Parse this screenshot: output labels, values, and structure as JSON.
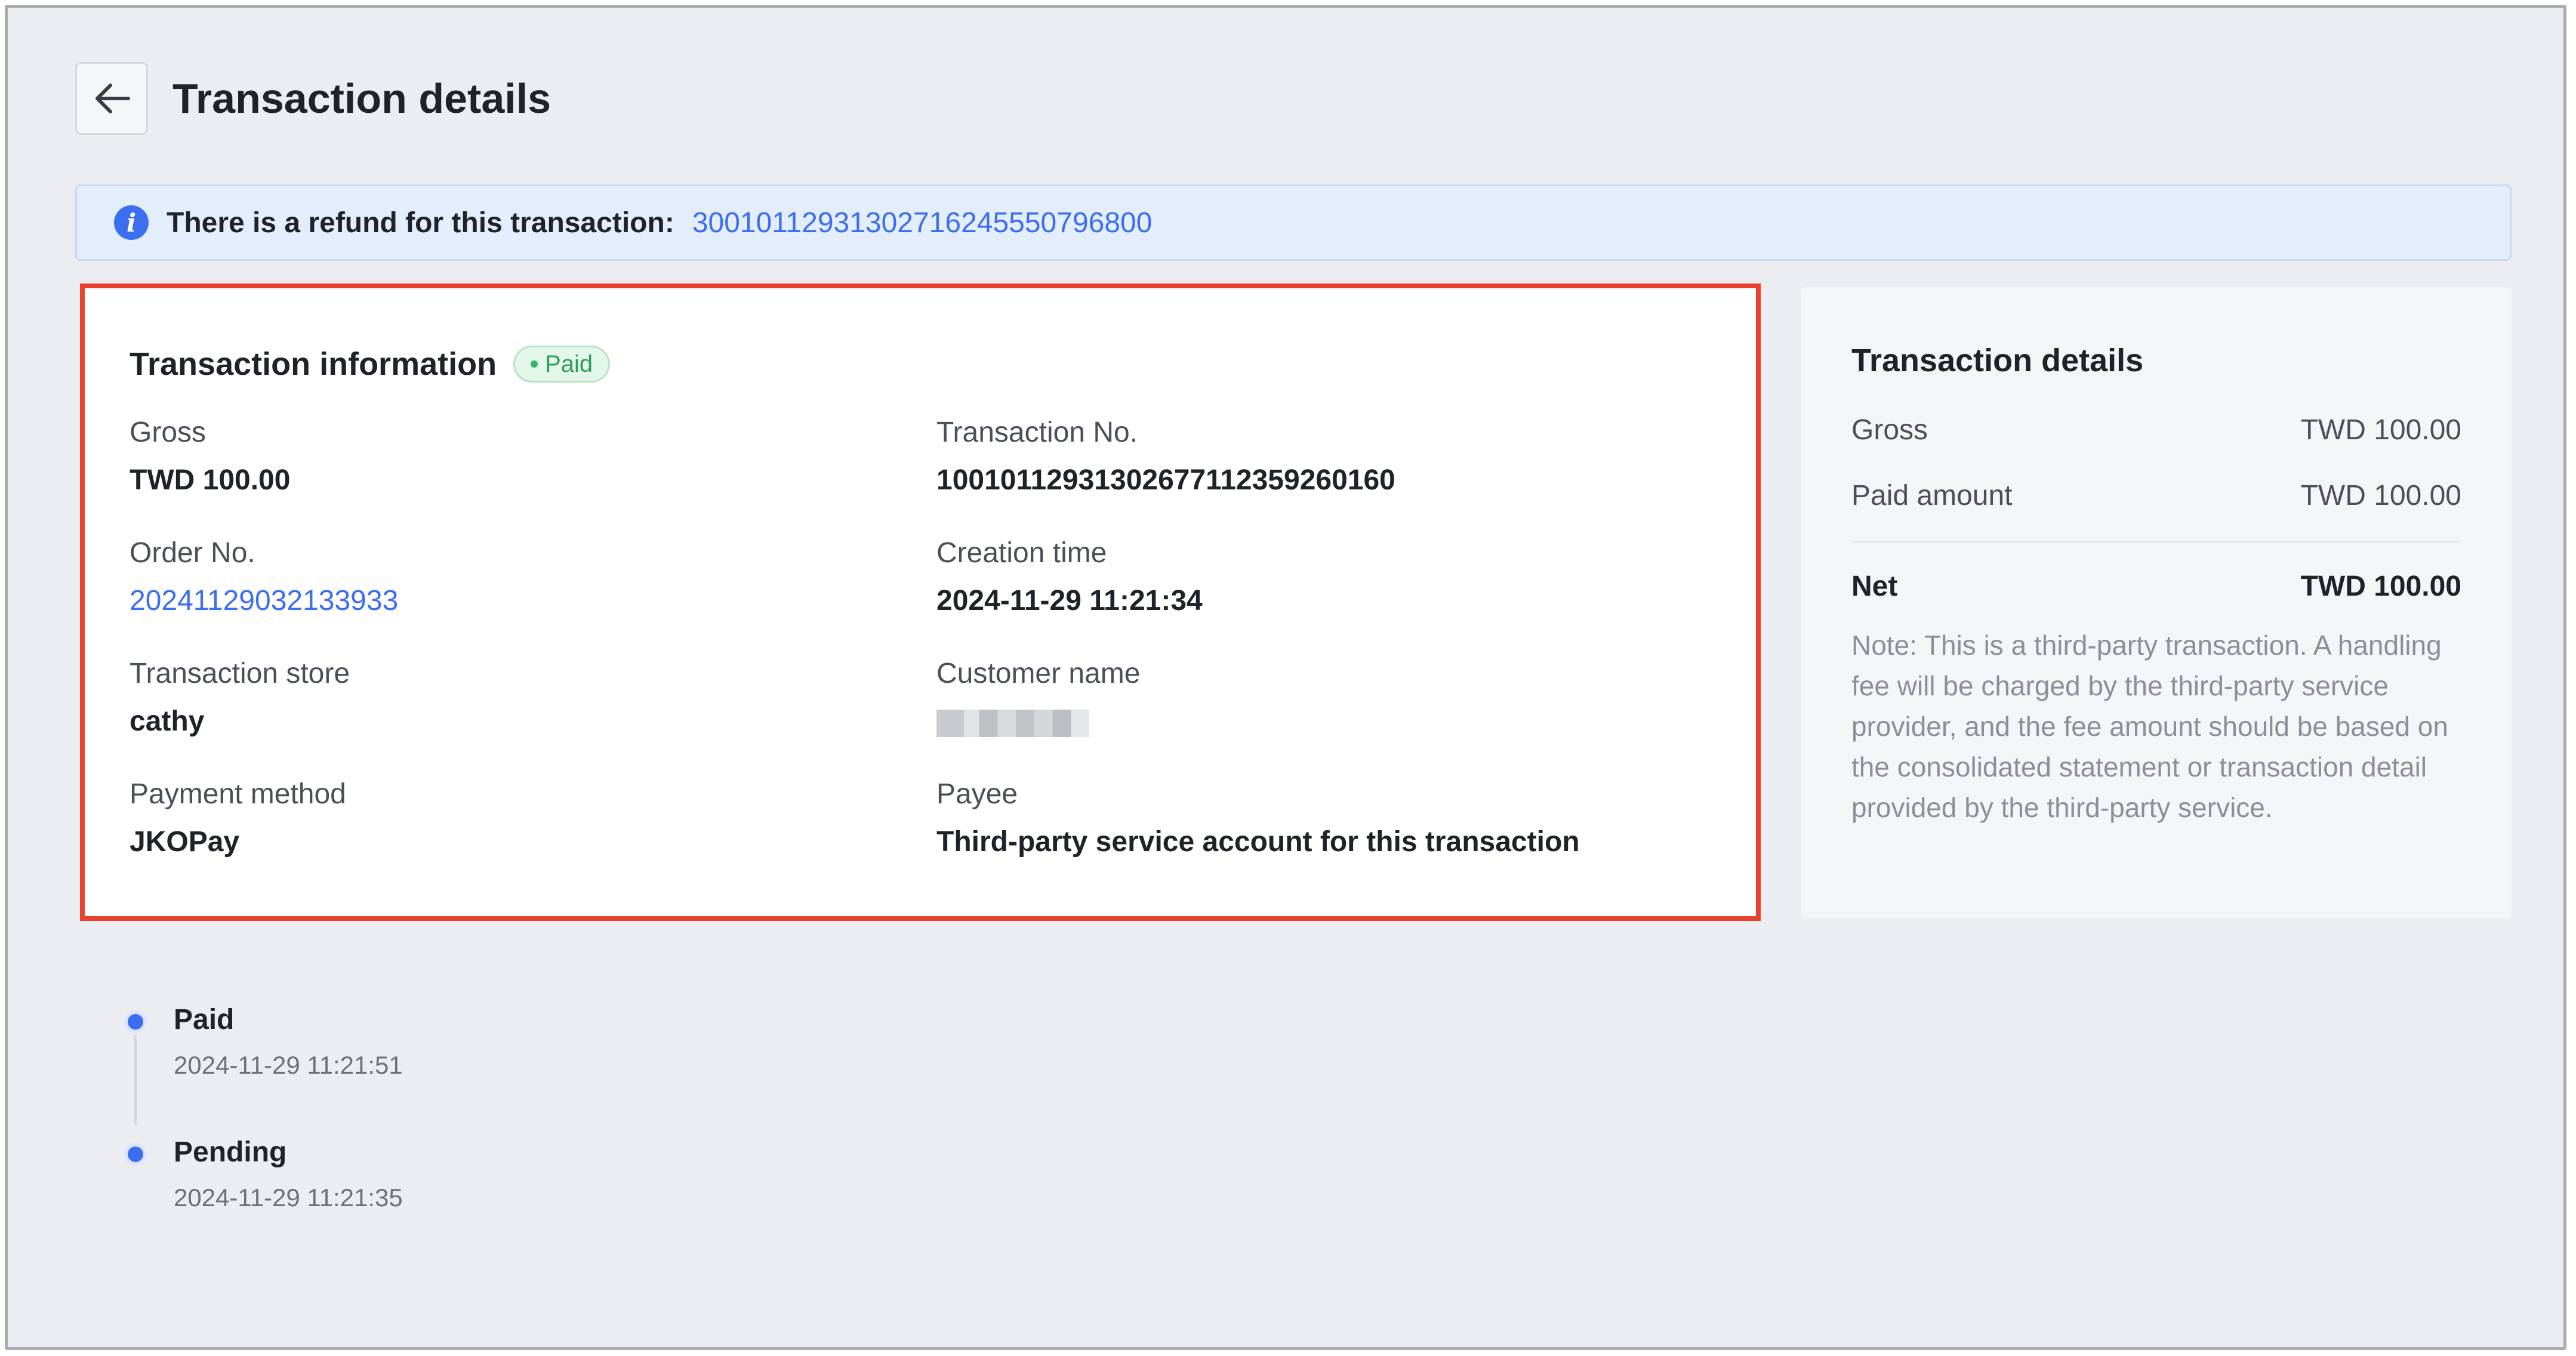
{
  "header": {
    "title": "Transaction details"
  },
  "banner": {
    "text": "There is a refund for this transaction:",
    "refund_id": "30010112931302716245550796800"
  },
  "transaction_info": {
    "title": "Transaction information",
    "status": "Paid",
    "fields": {
      "gross": {
        "label": "Gross",
        "value": "TWD 100.00"
      },
      "transaction_no": {
        "label": "Transaction No.",
        "value": "10010112931302677112359260160"
      },
      "order_no": {
        "label": "Order No.",
        "value": "20241129032133933"
      },
      "creation_time": {
        "label": "Creation time",
        "value": "2024-11-29 11:21:34"
      },
      "store": {
        "label": "Transaction store",
        "value": "cathy"
      },
      "customer": {
        "label": "Customer name"
      },
      "payment_method": {
        "label": "Payment method",
        "value": "JKOPay"
      },
      "payee": {
        "label": "Payee",
        "value": "Third-party service account for this transaction"
      }
    }
  },
  "summary": {
    "title": "Transaction details",
    "gross_label": "Gross",
    "gross_value": "TWD 100.00",
    "paid_label": "Paid amount",
    "paid_value": "TWD 100.00",
    "net_label": "Net",
    "net_value": "TWD 100.00",
    "note": "Note: This is a third-party transaction. A handling fee will be charged by the third-party service provider, and the fee amount should be based on the consolidated statement or transaction detail provided by the third-party service."
  },
  "timeline": [
    {
      "status": "Paid",
      "time": "2024-11-29 11:21:51"
    },
    {
      "status": "Pending",
      "time": "2024-11-29 11:21:35"
    }
  ],
  "colors": {
    "accent": "#3b6ef0",
    "highlight_border": "#e8422f",
    "paid_badge": "#2f9e5a"
  }
}
